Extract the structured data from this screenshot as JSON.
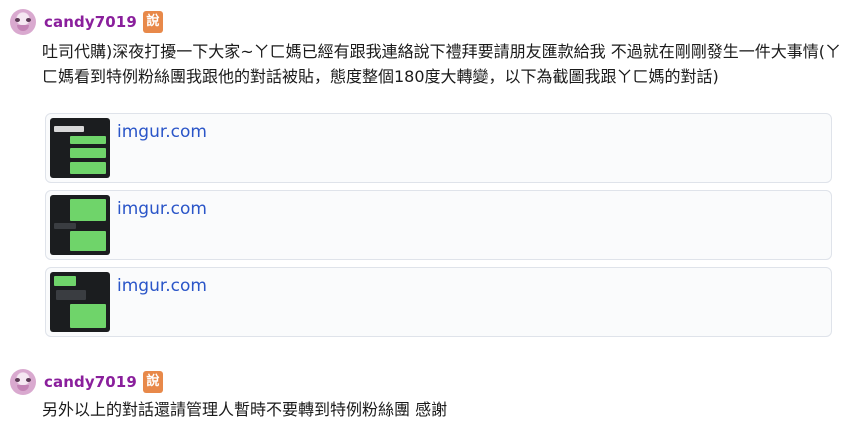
{
  "posts": [
    {
      "username": "candy7019",
      "badge": "說",
      "text": "吐司代購)深夜打擾一下大家~ㄚㄈ媽已經有跟我連絡說下禮拜要請朋友匯款給我 不過就在剛剛發生一件大事情(ㄚㄈ媽看到特例粉絲團我跟他的對話被貼，態度整個180度大轉變，以下為截圖我跟ㄚㄈ媽的對話)",
      "links": [
        {
          "domain": "imgur.com",
          "thumb_icon": "chat-screenshot-thumbnail"
        },
        {
          "domain": "imgur.com",
          "thumb_icon": "chat-screenshot-thumbnail"
        },
        {
          "domain": "imgur.com",
          "thumb_icon": "chat-screenshot-thumbnail"
        }
      ]
    },
    {
      "username": "candy7019",
      "badge": "說",
      "text": "另外以上的對話還請管理人暫時不要轉到特例粉絲團 感謝",
      "links": []
    }
  ],
  "colors": {
    "username": "#8a1f9c",
    "badge": "#e8894a",
    "link": "#2a55c8",
    "bubble_green": "#6fd46a"
  }
}
